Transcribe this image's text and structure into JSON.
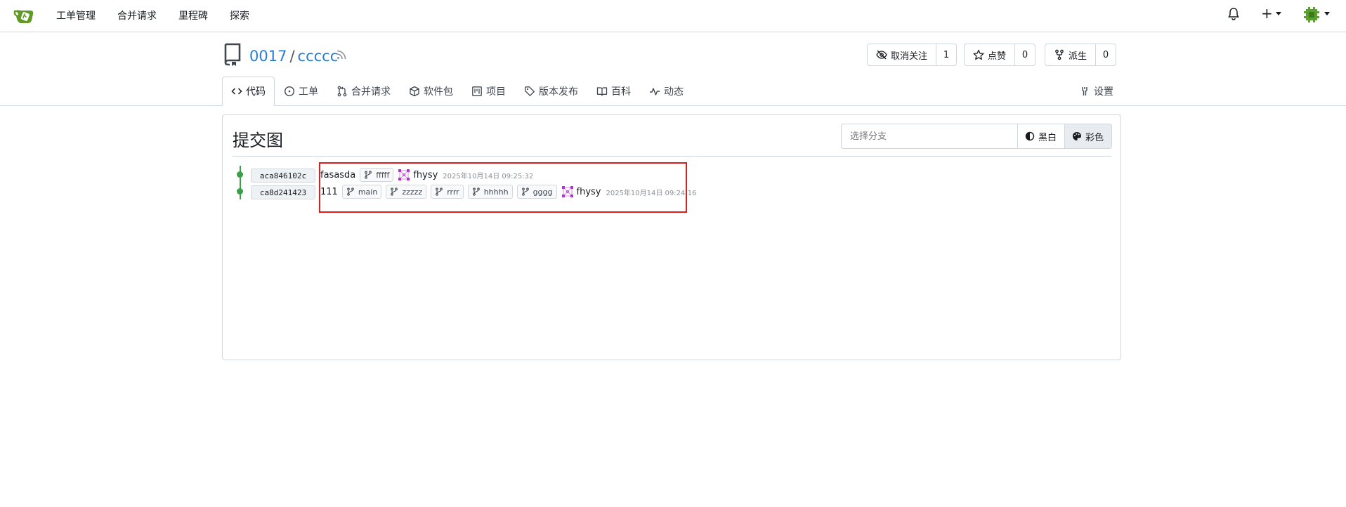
{
  "nav": {
    "items": [
      "工单管理",
      "合并请求",
      "里程碑",
      "探索"
    ],
    "plus_label": "+"
  },
  "repo": {
    "owner": "0017",
    "separator": "/",
    "name": "ccccc",
    "actions": [
      {
        "label": "取消关注",
        "count": "1"
      },
      {
        "label": "点赞",
        "count": "0"
      },
      {
        "label": "派生",
        "count": "0"
      }
    ]
  },
  "tabs": [
    "代码",
    "工单",
    "合并请求",
    "软件包",
    "项目",
    "版本发布",
    "百科",
    "动态",
    "设置"
  ],
  "graph": {
    "title": "提交图",
    "branch_placeholder": "选择分支",
    "mode_bw": "黑白",
    "mode_color": "彩色",
    "commits": [
      {
        "sha": "aca846102c",
        "message": "fasasda",
        "refs": [
          "fffff"
        ],
        "author": "fhysy",
        "date": "2025年10月14日 09:25:32"
      },
      {
        "sha": "ca8d241423",
        "message": "111",
        "refs": [
          "main",
          "zzzzz",
          "rrrr",
          "hhhhh",
          "gggg"
        ],
        "author": "fhysy",
        "date": "2025年10月14日 09:24:16"
      }
    ]
  },
  "colors": {
    "link": "#2b7bd0",
    "graph_line": "#3aa047",
    "highlight": "#e21b1b",
    "logo": "#609926",
    "avatar_purple": "#b531d6"
  }
}
